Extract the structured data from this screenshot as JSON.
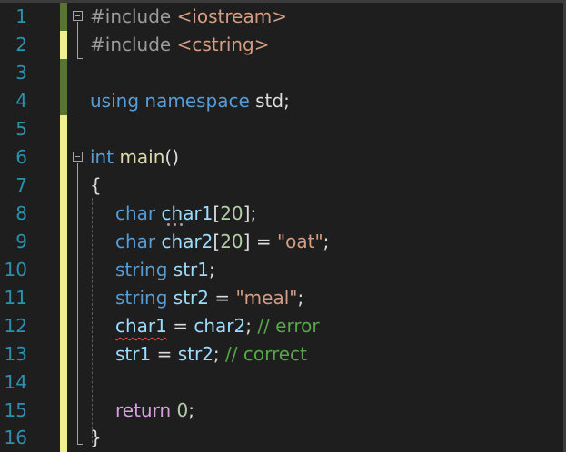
{
  "editor": {
    "line_numbers": [
      "1",
      "2",
      "3",
      "4",
      "5",
      "6",
      "7",
      "8",
      "9",
      "10",
      "11",
      "12",
      "13",
      "14",
      "15",
      "16"
    ],
    "lines": {
      "l1": {
        "directive": "#include",
        "header": "<iostream>"
      },
      "l2": {
        "directive": "#include",
        "header": "<cstring>"
      },
      "l4": {
        "kw_using": "using",
        "kw_namespace": "namespace",
        "rest": " std;"
      },
      "l6": {
        "kw_int": "int",
        "func": "main",
        "parens": "()"
      },
      "l7": {
        "brace": "{"
      },
      "l8": {
        "kw_char": "char",
        "var": "char1",
        "rest": "[",
        "num": "20",
        "tail": "];"
      },
      "l9": {
        "kw_char": "char",
        "var": "char2",
        "rest": "[",
        "num": "20",
        "mid": "] = ",
        "str": "\"oat\"",
        "tail": ";"
      },
      "l10": {
        "kw_string": "string",
        "var": "str1",
        "tail": ";"
      },
      "l11": {
        "kw_string": "string",
        "var": "str2",
        "mid": " = ",
        "str": "\"meal\"",
        "tail": ";"
      },
      "l12": {
        "var_a": "char1",
        "mid": " = ",
        "var_b": "char2",
        "tail": "; ",
        "comment": "// error"
      },
      "l13": {
        "var_a": "str1",
        "mid": " = ",
        "var_b": "str2",
        "tail": "; ",
        "comment": "// correct"
      },
      "l15": {
        "kw_return": "return",
        "num": "0",
        "tail": ";"
      },
      "l16": {
        "brace": "}"
      }
    }
  },
  "colors": {
    "background": "#1e1e1e",
    "line_number": "#2b91af",
    "keyword": "#569cd6",
    "preprocessor": "#9b9b9b",
    "string": "#d69d85",
    "number": "#b5cea8",
    "function": "#dcdcaa",
    "variable": "#9cdcfe",
    "comment": "#57a64a",
    "control": "#d8a0df",
    "change_saved": "#577430",
    "change_unsaved": "#efef91",
    "error_squiggle": "#f14c4c"
  }
}
